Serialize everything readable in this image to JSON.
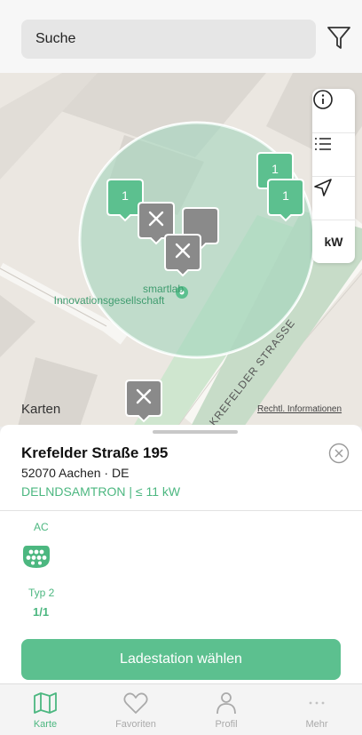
{
  "search": {
    "placeholder": "Suche"
  },
  "map": {
    "poi_name_line1": "smartlab",
    "poi_name_line2": "Innovationsgesellschaft",
    "street_label": "KREFELDER STRASSE",
    "brand": "Karten",
    "legal": "Rechtl. Informationen",
    "markers": [
      {
        "kind": "available",
        "count": "1"
      },
      {
        "kind": "available",
        "count": "1"
      },
      {
        "kind": "available",
        "count": "1"
      },
      {
        "kind": "unavailable",
        "count": ""
      },
      {
        "kind": "unavailable",
        "count": ""
      },
      {
        "kind": "unavailable",
        "count": ""
      },
      {
        "kind": "unavailable",
        "count": ""
      }
    ],
    "tools": {
      "info_icon": "info-icon",
      "list_icon": "list-icon",
      "locate_icon": "location-arrow-icon",
      "kw_label": "kW"
    }
  },
  "station": {
    "title": "Krefelder Straße 195",
    "city": "52070 Aachen · DE",
    "operator": "DELNDSAMTRON | ≤ 11 kW",
    "connector": {
      "current": "AC",
      "name": "Typ 2",
      "availability": "1/1"
    },
    "action_label": "Ladestation wählen"
  },
  "tabs": [
    {
      "label": "Karte",
      "icon": "map-icon",
      "active": true
    },
    {
      "label": "Favoriten",
      "icon": "heart-icon",
      "active": false
    },
    {
      "label": "Profil",
      "icon": "person-icon",
      "active": false
    },
    {
      "label": "Mehr",
      "icon": "more-icon",
      "active": false
    }
  ],
  "colors": {
    "accent": "#4cb780",
    "marker_green": "#5cc08f",
    "marker_grey": "#8a8a8a",
    "map_bg": "#ebe7e1"
  }
}
